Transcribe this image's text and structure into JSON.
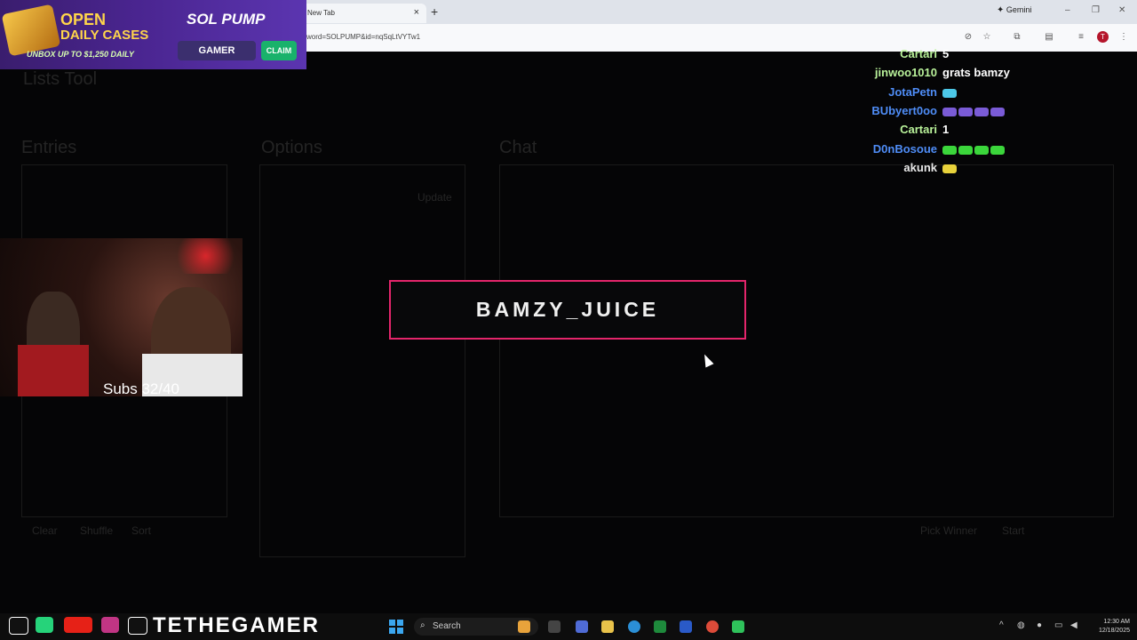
{
  "browser": {
    "tab_title": "New Tab",
    "tab_close": "×",
    "new_tab": "+",
    "gemini_label": "Gemini",
    "url": "word=SOLPUMP&id=nqSqLtVYTw1",
    "profile_initial": "T",
    "window_controls": [
      "–",
      "❐",
      "✕"
    ]
  },
  "promo": {
    "open": "OPEN",
    "cases": "DAILY CASES",
    "unbox": "UNBOX UP TO $1,250 DAILY",
    "logo": "SOL PUMP",
    "gamer": "GAMER",
    "claim": "CLAIM"
  },
  "webcam": {
    "subs_text": "Subs 32/40"
  },
  "banner": {
    "name": "BAMZY_JUICE"
  },
  "chat": [
    {
      "user": "Cartari",
      "color": "#b9f29a",
      "msg": "5",
      "emotes": []
    },
    {
      "user": "jinwoo1010",
      "color": "#b9f29a",
      "msg": "grats bamzy",
      "emotes": []
    },
    {
      "user": "JotaPetn",
      "color": "#4f8df7",
      "msg": "",
      "emotes": [
        "#4cc8e8"
      ]
    },
    {
      "user": "BUbyert0oo",
      "color": "#4f8df7",
      "msg": "",
      "emotes": [
        "#7a5bd6",
        "#7a5bd6",
        "#7a5bd6",
        "#7a5bd6"
      ]
    },
    {
      "user": "Cartari",
      "color": "#b9f29a",
      "msg": "1",
      "emotes": []
    },
    {
      "user": "D0nBosoue",
      "color": "#4f8df7",
      "msg": "",
      "emotes": [
        "#3bd63b",
        "#3bd63b",
        "#3bd63b",
        "#3bd63b"
      ]
    },
    {
      "user": "akunk",
      "color": "#e8e8e8",
      "msg": "",
      "emotes": [
        "#e8d23b"
      ]
    }
  ],
  "background_page": {
    "title": "Lists Tool",
    "sections": [
      "Entries",
      "Options",
      "Chat"
    ],
    "buttons": [
      "Clear",
      "Shuffle",
      "Sort",
      "Update",
      "Pick Winner",
      "Start"
    ]
  },
  "taskbar": {
    "socials_text": "TETHEGAMER",
    "search_label": "Search",
    "time": "12:30 AM",
    "date": "12/18/2025"
  }
}
